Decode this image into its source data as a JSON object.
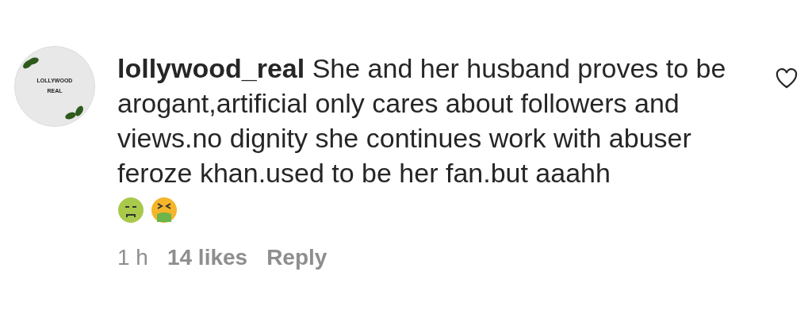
{
  "comment": {
    "avatar_text": "LOLLYWOOD REAL",
    "username": "lollywood_real",
    "text": "She and her husband proves to be arogant,artificial only cares about followers and views.no dignity she continues work with abuser feroze khan.used to be her fan.but aaahh",
    "emojis": [
      {
        "kind": "nauseated"
      },
      {
        "kind": "vomiting"
      }
    ],
    "liked": false,
    "time": "1 h",
    "likes": "14 likes",
    "reply": "Reply"
  }
}
